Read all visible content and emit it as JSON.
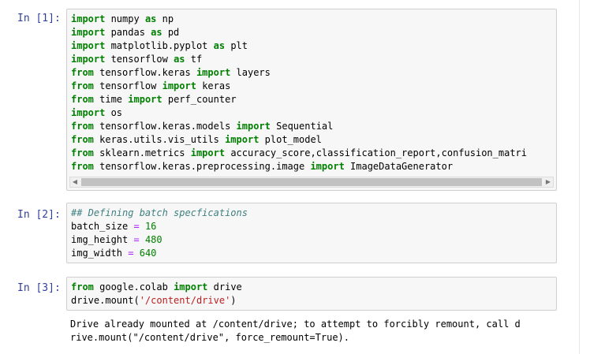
{
  "cells": [
    {
      "prompt": "In [1]:",
      "lines": [
        [
          {
            "t": "import",
            "c": "kw"
          },
          {
            "t": " numpy "
          },
          {
            "t": "as",
            "c": "kw"
          },
          {
            "t": " np"
          }
        ],
        [
          {
            "t": "import",
            "c": "kw"
          },
          {
            "t": " pandas "
          },
          {
            "t": "as",
            "c": "kw"
          },
          {
            "t": " pd"
          }
        ],
        [
          {
            "t": "import",
            "c": "kw"
          },
          {
            "t": " matplotlib.pyplot "
          },
          {
            "t": "as",
            "c": "kw"
          },
          {
            "t": " plt"
          }
        ],
        [
          {
            "t": "import",
            "c": "kw"
          },
          {
            "t": " tensorflow "
          },
          {
            "t": "as",
            "c": "kw"
          },
          {
            "t": " tf"
          }
        ],
        [
          {
            "t": "from",
            "c": "kw"
          },
          {
            "t": " tensorflow.keras "
          },
          {
            "t": "import",
            "c": "kw"
          },
          {
            "t": " layers"
          }
        ],
        [
          {
            "t": "from",
            "c": "kw"
          },
          {
            "t": " tensorflow "
          },
          {
            "t": "import",
            "c": "kw"
          },
          {
            "t": " keras"
          }
        ],
        [
          {
            "t": "from",
            "c": "kw"
          },
          {
            "t": " time "
          },
          {
            "t": "import",
            "c": "kw"
          },
          {
            "t": " perf_counter"
          }
        ],
        [
          {
            "t": "import",
            "c": "kw"
          },
          {
            "t": " os"
          }
        ],
        [
          {
            "t": "from",
            "c": "kw"
          },
          {
            "t": " tensorflow.keras.models "
          },
          {
            "t": "import",
            "c": "kw"
          },
          {
            "t": " Sequential"
          }
        ],
        [
          {
            "t": "from",
            "c": "kw"
          },
          {
            "t": " keras.utils.vis_utils "
          },
          {
            "t": "import",
            "c": "kw"
          },
          {
            "t": " plot_model"
          }
        ],
        [
          {
            "t": "from",
            "c": "kw"
          },
          {
            "t": " sklearn.metrics "
          },
          {
            "t": "import",
            "c": "kw"
          },
          {
            "t": " accuracy_score,classification_report,confusion_matri"
          }
        ],
        [
          {
            "t": "from",
            "c": "kw"
          },
          {
            "t": " tensorflow.keras.preprocessing.image "
          },
          {
            "t": "import",
            "c": "kw"
          },
          {
            "t": " ImageDataGenerator"
          }
        ]
      ],
      "scroll_left": "◀",
      "scroll_right": "▶"
    },
    {
      "prompt": "In [2]:",
      "lines": [
        [
          {
            "t": "## Defining batch specfications",
            "c": "cm"
          }
        ],
        [
          {
            "t": "batch_size "
          },
          {
            "t": "=",
            "c": "op"
          },
          {
            "t": " "
          },
          {
            "t": "16",
            "c": "num"
          }
        ],
        [
          {
            "t": "img_height "
          },
          {
            "t": "=",
            "c": "op"
          },
          {
            "t": " "
          },
          {
            "t": "480",
            "c": "num"
          }
        ],
        [
          {
            "t": "img_width "
          },
          {
            "t": "=",
            "c": "op"
          },
          {
            "t": " "
          },
          {
            "t": "640",
            "c": "num"
          }
        ]
      ]
    },
    {
      "prompt": "In [3]:",
      "lines": [
        [
          {
            "t": "from",
            "c": "kw"
          },
          {
            "t": " google.colab "
          },
          {
            "t": "import",
            "c": "kw"
          },
          {
            "t": " drive"
          }
        ],
        [
          {
            "t": "drive.mount("
          },
          {
            "t": "'/content/drive'",
            "c": "str"
          },
          {
            "t": ")"
          }
        ]
      ],
      "output": [
        "Drive already mounted at /content/drive; to attempt to forcibly remount, call d",
        "rive.mount(\"/content/drive\", force_remount=True)."
      ]
    }
  ],
  "colors": {
    "keyword": "#008000",
    "operator": "#aa22ff",
    "number": "#008000",
    "string": "#ba2121",
    "comment": "#408080",
    "prompt": "#303f9f"
  }
}
